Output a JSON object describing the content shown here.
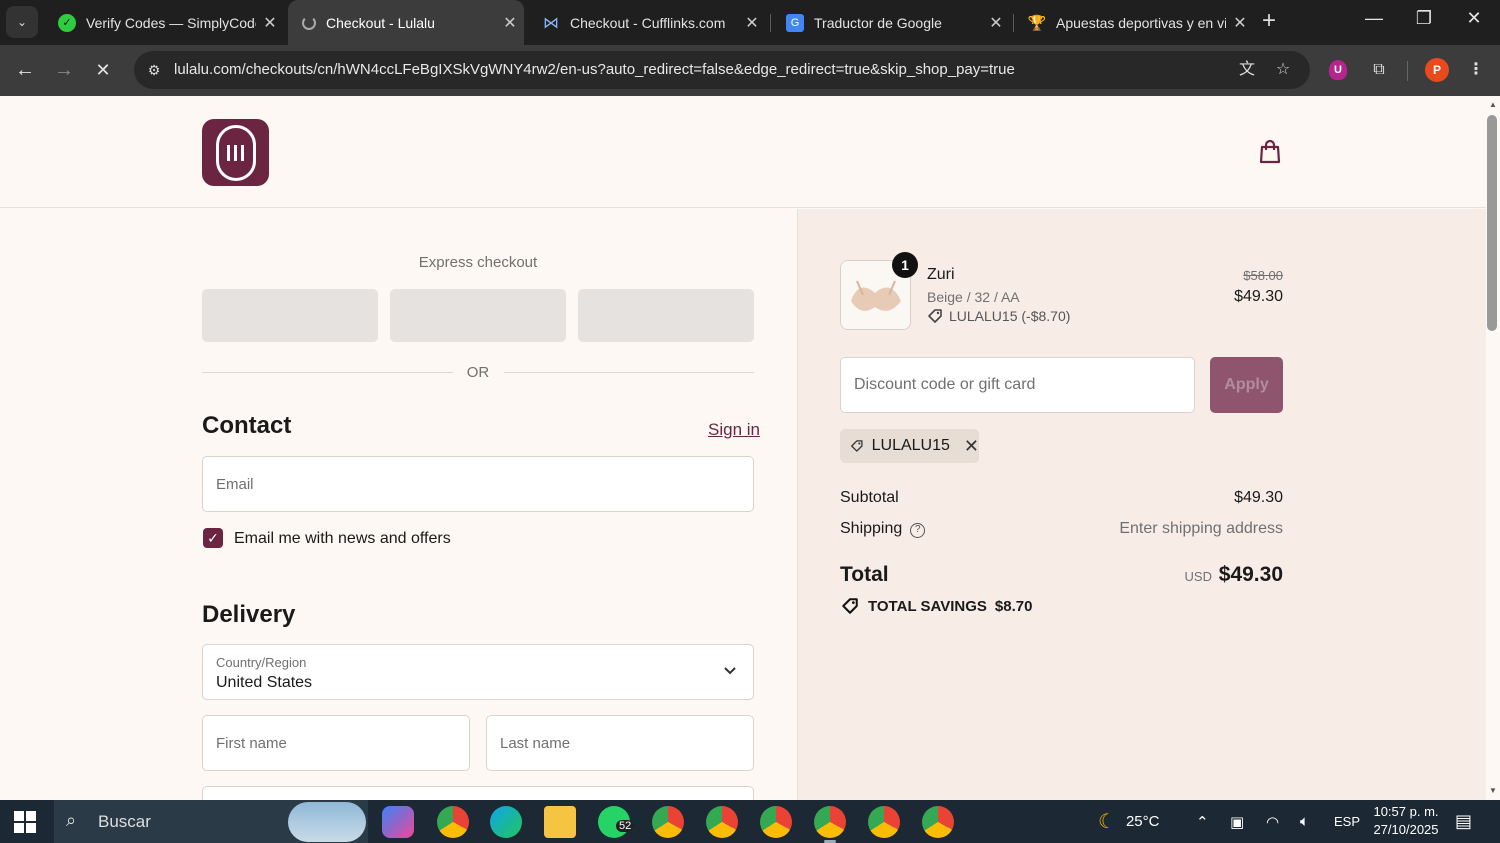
{
  "browser": {
    "tabs": [
      {
        "title": "Verify Codes — SimplyCodes",
        "icon": "simplycodes-icon"
      },
      {
        "title": "Checkout - Lulalu",
        "icon": "loading-icon"
      },
      {
        "title": "Checkout - Cufflinks.com",
        "icon": "cufflinks-icon"
      },
      {
        "title": "Traductor de Google",
        "icon": "google-translate-icon"
      },
      {
        "title": "Apuestas deportivas y en vivo",
        "icon": "trophy-icon"
      }
    ],
    "url": "lulalu.com/checkouts/cn/hWN4ccLFeBgIXSkVgWNY4rw2/en-us?auto_redirect=false&edge_redirect=true&skip_shop_pay=true",
    "profile_initial": "P",
    "extension_initial": "U"
  },
  "checkout": {
    "express_label": "Express checkout",
    "or_label": "OR",
    "contact_title": "Contact",
    "sign_in": "Sign in",
    "email_placeholder": "Email",
    "news_label": "Email me with news and offers",
    "news_checked": true,
    "delivery_title": "Delivery",
    "country_label": "Country/Region",
    "country_value": "United States",
    "first_name_placeholder": "First name",
    "last_name_placeholder": "Last name"
  },
  "summary": {
    "quantity": "1",
    "product_name": "Zuri",
    "variant": "Beige / 32 / AA",
    "discount_line": "LULALU15 (-$8.70)",
    "price_original": "$58.00",
    "price_final": "$49.30",
    "discount_placeholder": "Discount code or gift card",
    "apply_label": "Apply",
    "applied_code": "LULALU15",
    "subtotal_label": "Subtotal",
    "subtotal_value": "$49.30",
    "shipping_label": "Shipping",
    "shipping_value": "Enter shipping address",
    "total_label": "Total",
    "total_currency": "USD",
    "total_value": "$49.30",
    "savings_label": "TOTAL SAVINGS",
    "savings_value": "$8.70"
  },
  "taskbar": {
    "search_label": "Buscar",
    "whatsapp_badge": "52",
    "temperature": "25°C",
    "language": "ESP",
    "time": "10:57 p. m.",
    "date": "27/10/2025"
  },
  "colors": {
    "brand": "#6b2541",
    "page_bg": "#fdf8f4",
    "summary_bg": "#f7ede6"
  }
}
